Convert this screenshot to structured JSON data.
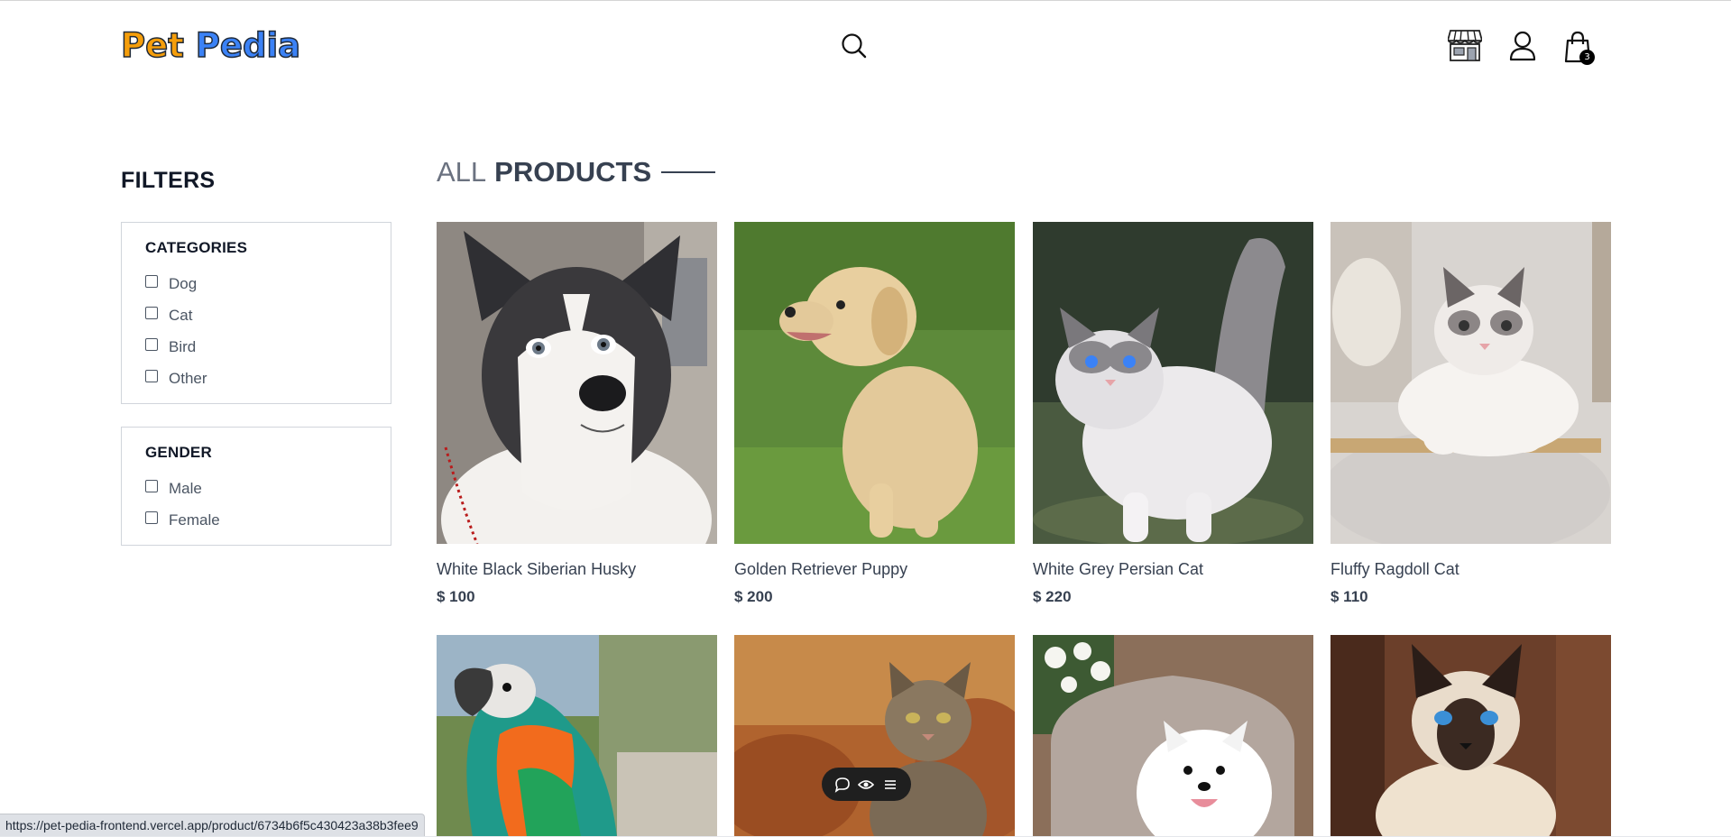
{
  "header": {
    "logo_part1": "Pet",
    "logo_part2": "Pedia",
    "cart_count": "3"
  },
  "filters": {
    "title": "FILTERS",
    "categories": {
      "heading": "CATEGORIES",
      "options": [
        "Dog",
        "Cat",
        "Bird",
        "Other"
      ]
    },
    "gender": {
      "heading": "GENDER",
      "options": [
        "Male",
        "Female"
      ]
    }
  },
  "products": {
    "heading_light": "ALL",
    "heading_bold": "PRODUCTS",
    "items": [
      {
        "name": "White Black Siberian Husky",
        "price": "$ 100"
      },
      {
        "name": "Golden Retriever Puppy",
        "price": "$ 200"
      },
      {
        "name": "White Grey Persian Cat",
        "price": "$ 220"
      },
      {
        "name": "Fluffy Ragdoll Cat",
        "price": "$ 110"
      }
    ]
  },
  "status_bar": {
    "url": "https://pet-pedia-frontend.vercel.app/product/6734b6f5c430423a38b3fee9"
  }
}
